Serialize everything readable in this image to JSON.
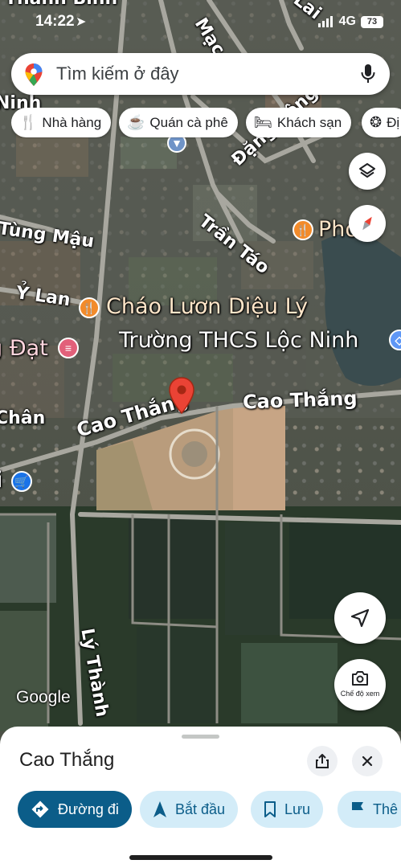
{
  "status_bar": {
    "time": "14:22",
    "network": "4G",
    "battery": "73"
  },
  "search": {
    "placeholder": "Tìm kiếm ở đây"
  },
  "chips": [
    {
      "label": "Nhà hàng",
      "icon": "fork-knife-icon"
    },
    {
      "label": "Quán cà phê",
      "icon": "coffee-cup-icon"
    },
    {
      "label": "Khách sạn",
      "icon": "bed-icon"
    },
    {
      "label": "Đị",
      "icon": "attractions-icon"
    }
  ],
  "map": {
    "top_partial_label": "Thanh Bình",
    "street_labels": {
      "mac": "Mạc T",
      "lai": "Lai",
      "ninh": "Ninh",
      "dang_cong": "Đặng Công",
      "tran_tao": "Trần Táo",
      "tung_mau": "Tùng Mậu",
      "y_lan": "Ỷ Lan",
      "cao_thang_left": "Cao Thắng",
      "cao_thang_right": "Cao Thắng",
      "chan": "Chân",
      "ly_thanh": "Lý Thành"
    },
    "poi_labels": {
      "chao_luon": "Cháo Lươn Diệu Lý",
      "truong": "Trường THCS Lộc Ninh",
      "pho": "Phở H",
      "dat": "g Đạt",
      "shop": "i"
    },
    "colors": {
      "restaurant_pin": "#f28b2b",
      "hotel_pin": "#e2607a",
      "shop_pin": "#1a73e8",
      "school_pin": "#5e97f6",
      "selected_pin": "#ea4335"
    }
  },
  "map_controls": {
    "streetview_label": "Chế độ xem"
  },
  "google_logo": "Google",
  "sheet": {
    "title": "Cao Thắng",
    "actions": [
      {
        "label": "Đường đi",
        "icon": "directions-icon"
      },
      {
        "label": "Bắt đầu",
        "icon": "navigation-arrow-icon"
      },
      {
        "label": "Lưu",
        "icon": "bookmark-icon"
      },
      {
        "label": "Thê",
        "icon": "flag-icon"
      }
    ]
  }
}
